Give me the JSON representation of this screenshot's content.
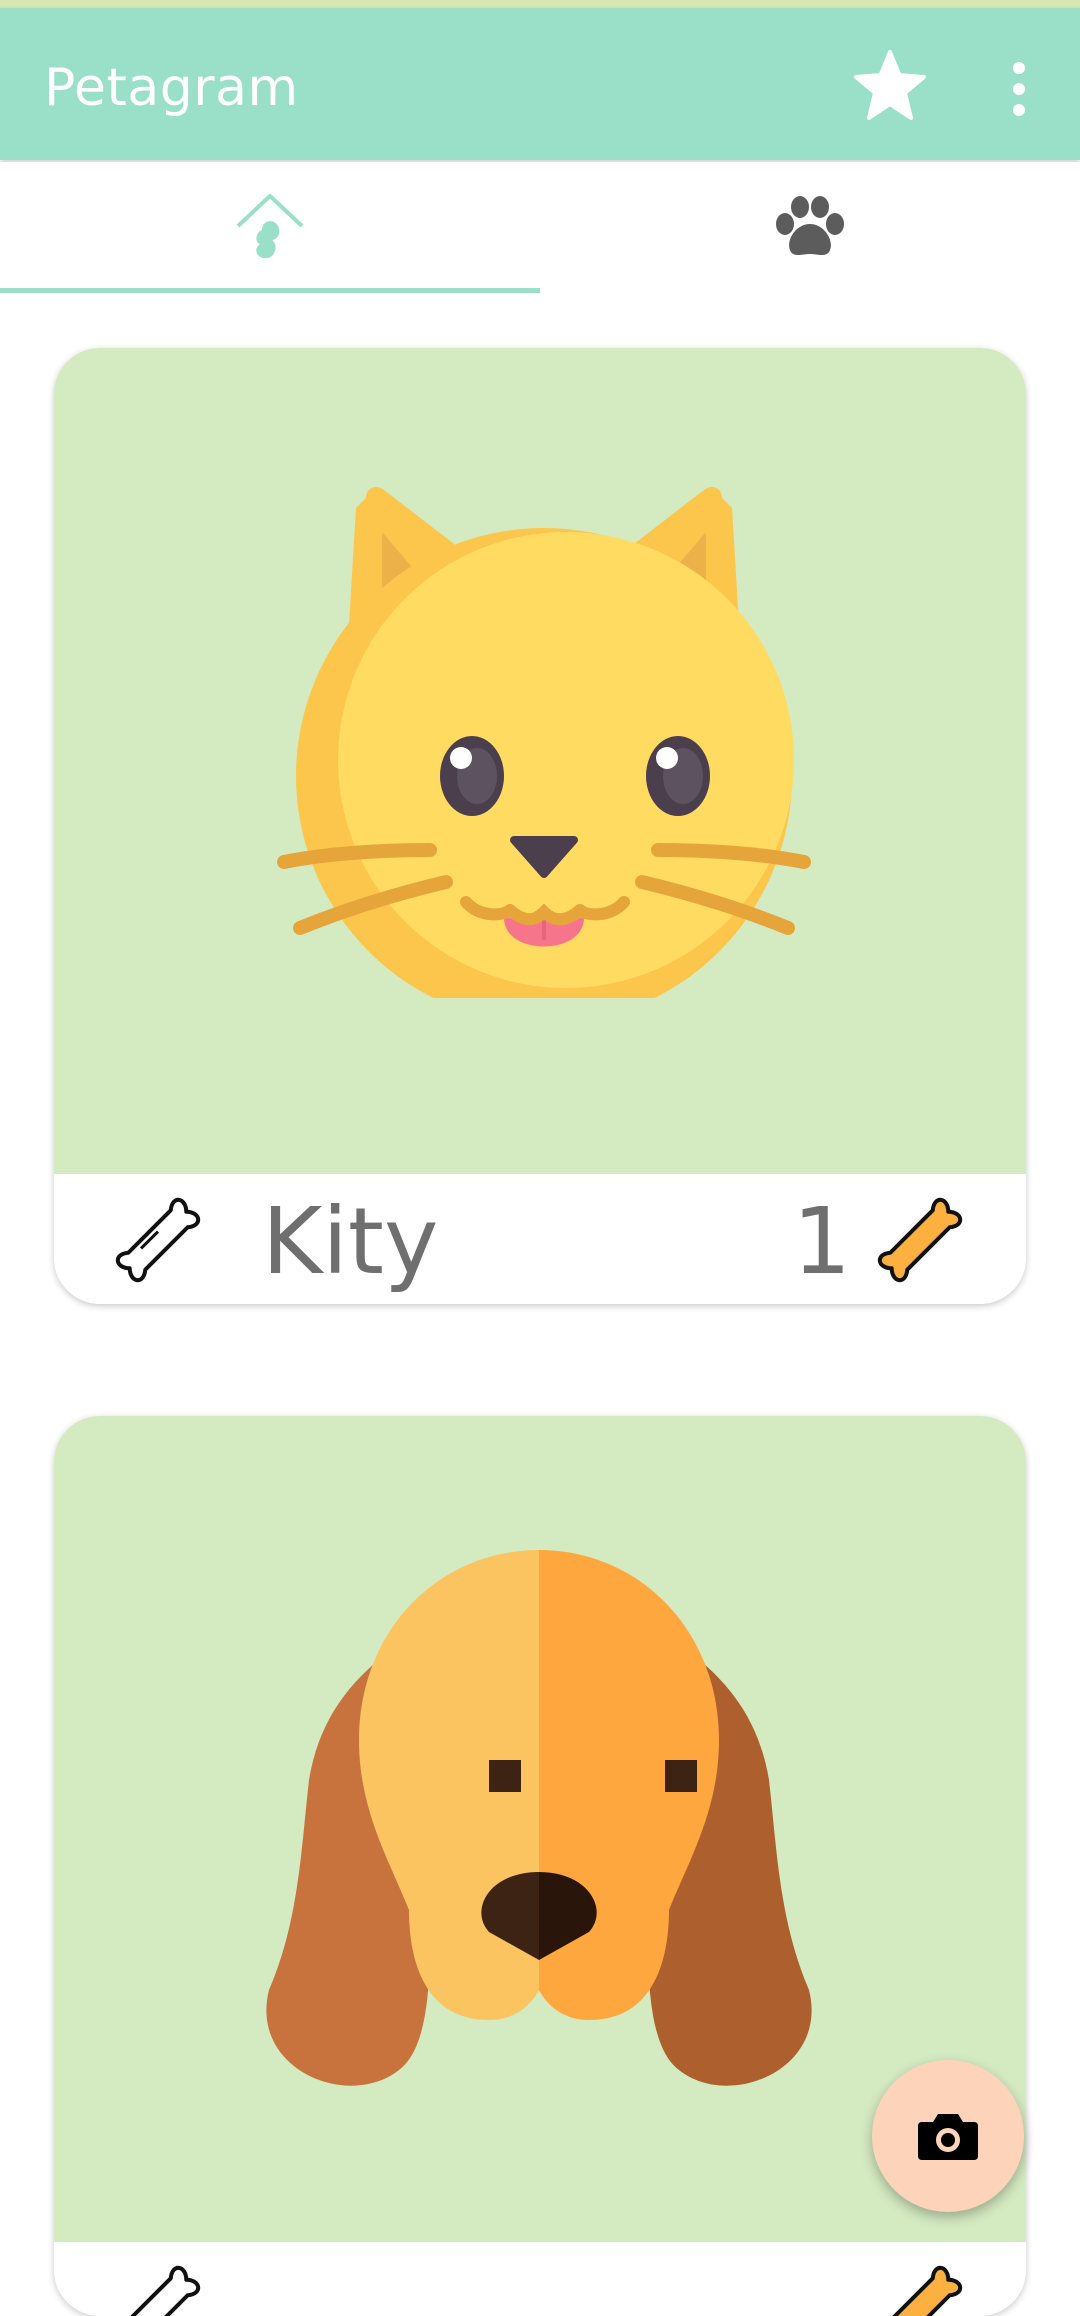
{
  "app_bar": {
    "title": "Petagram",
    "background_color": "#9adfc8",
    "actions": [
      "star-icon",
      "more-vert-icon"
    ]
  },
  "tabs": [
    {
      "icon": "home-pet-icon",
      "selected": true
    },
    {
      "icon": "paw-icon",
      "selected": false
    }
  ],
  "pets": [
    {
      "name": "Kity",
      "rating": "1",
      "image": "cat-face",
      "bone_button_icon": "bone-outline-icon",
      "rating_icon": "bone-filled-icon"
    },
    {
      "name": "",
      "rating": "",
      "image": "dog-face",
      "bone_button_icon": "bone-outline-icon",
      "rating_icon": "bone-filled-icon"
    }
  ],
  "fab": {
    "icon": "camera-icon",
    "color": "#fdd4b9"
  },
  "colors": {
    "accent": "#9adfc8",
    "card_image_bg": "#d4eac1",
    "text_muted": "#6f6f6f",
    "bone_filled": "#fbb040"
  }
}
